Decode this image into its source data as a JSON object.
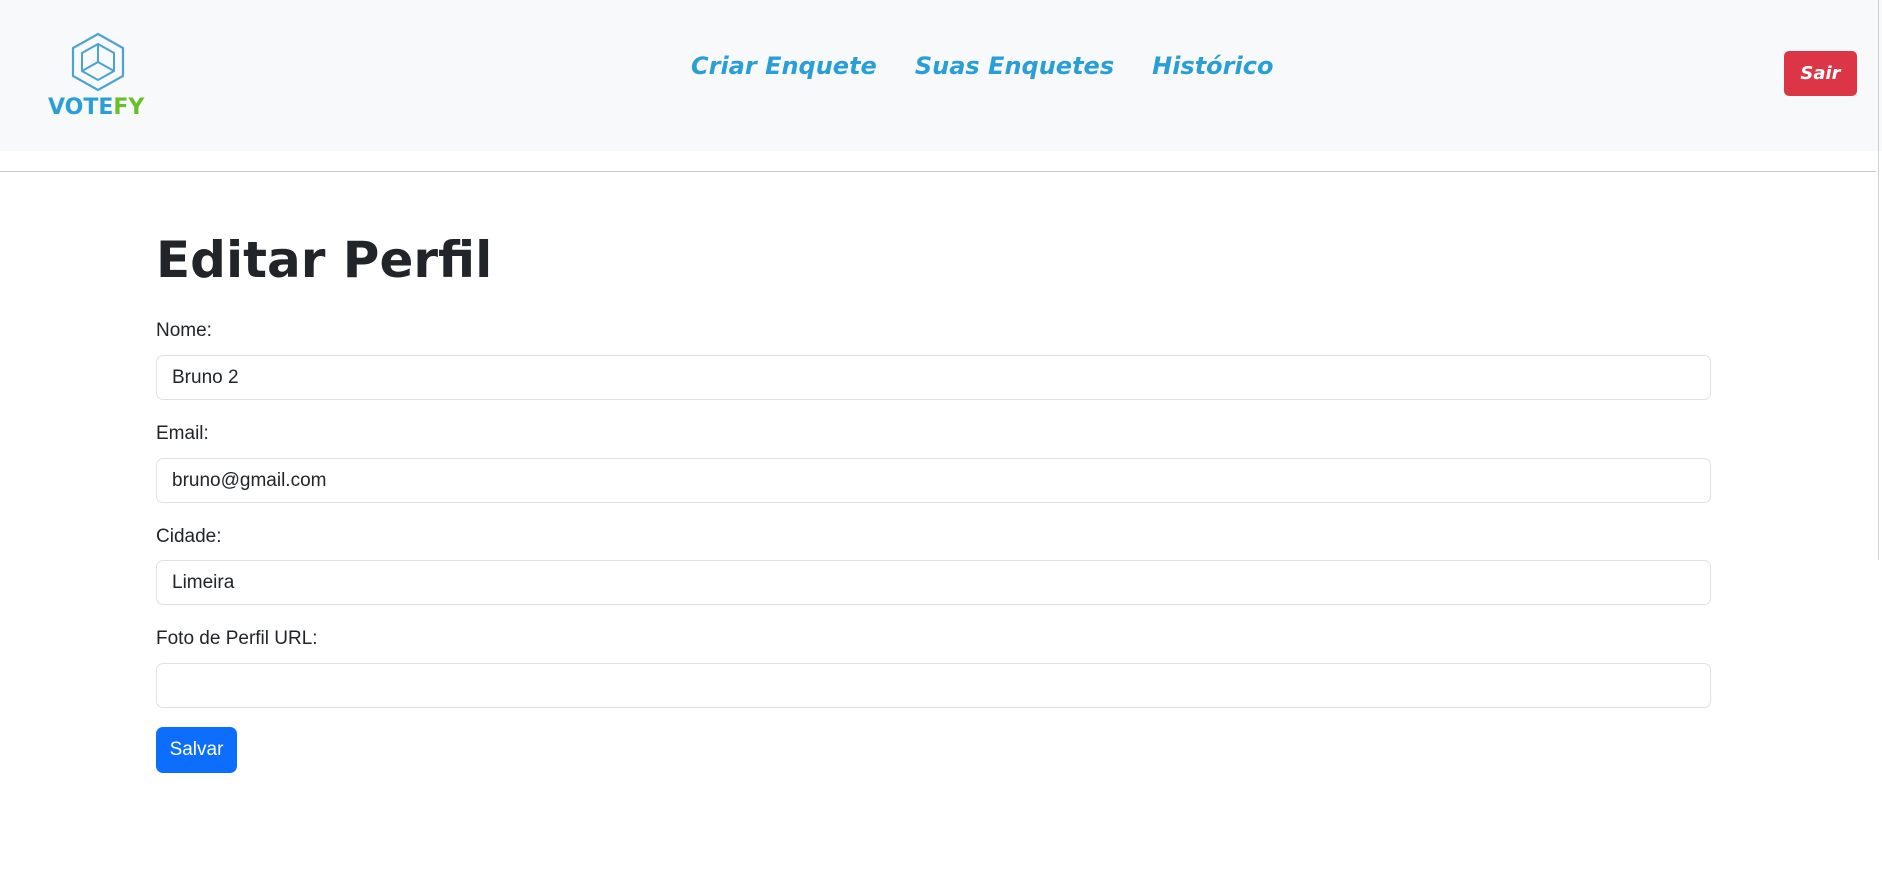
{
  "brand": {
    "logo_v": "V",
    "logo_ote": "OTE",
    "logo_fy": "FY"
  },
  "nav": {
    "items": [
      {
        "label": "Criar Enquete"
      },
      {
        "label": "Suas Enquetes"
      },
      {
        "label": "Histórico"
      }
    ],
    "logout_label": "Sair"
  },
  "form": {
    "title": "Editar Perfil",
    "fields": [
      {
        "label": "Nome:",
        "value": "Bruno 2"
      },
      {
        "label": "Email:",
        "value": "bruno@gmail.com"
      },
      {
        "label": "Cidade:",
        "value": "Limeira"
      },
      {
        "label": "Foto de Perfil URL:",
        "value": ""
      }
    ],
    "submit_label": "Salvar"
  },
  "colors": {
    "link": "#2a9fd6",
    "logo_green": "#66c02a",
    "danger": "#dc3545",
    "primary": "#0d6efd",
    "header_bg": "#f8f9fa"
  }
}
